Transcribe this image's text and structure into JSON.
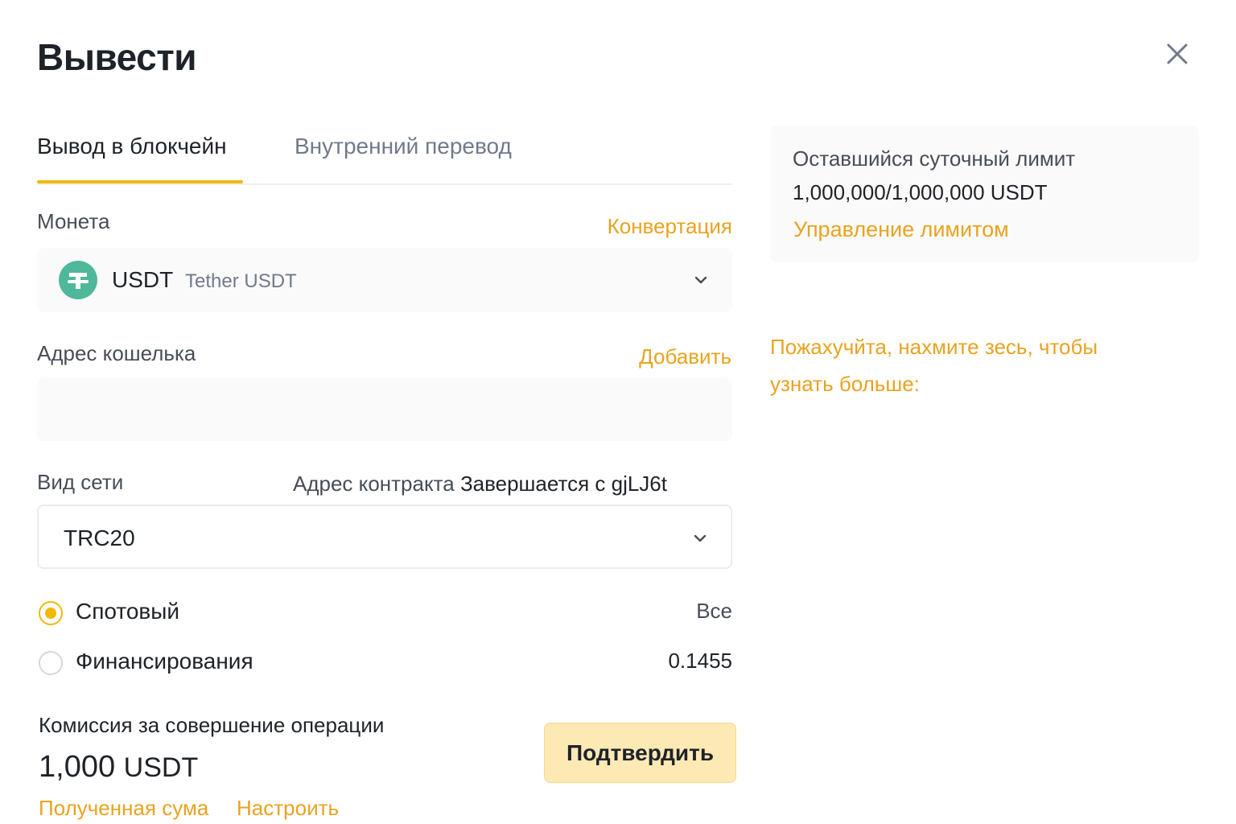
{
  "header": {
    "title": "Вывести",
    "close_icon": "close-icon"
  },
  "tabs": [
    {
      "label": "Вывод в блокчейн",
      "active": true
    },
    {
      "label": "Внутренний перевод",
      "active": false
    }
  ],
  "coin": {
    "label": "Монета",
    "convert_link": "Конвертация",
    "symbol": "USDT",
    "name": "Tether USDT",
    "icon": "tether-icon",
    "icon_color": "#50b89a"
  },
  "wallet": {
    "label": "Адрес кошелька",
    "add_link": "Добавить",
    "value": "",
    "placeholder": ""
  },
  "network": {
    "label": "Вид сети",
    "contract_label": "Адрес контракта",
    "contract_value": "Завершается с gjLJ6t",
    "selected": "TRC20"
  },
  "accounts": [
    {
      "label": "Спотовый",
      "value": "Все",
      "selected": true
    },
    {
      "label": "Финансирования",
      "value": "0.1455",
      "selected": false
    }
  ],
  "fee": {
    "label": "Комиссия за совершение операции",
    "amount": "1,000",
    "unit": "USDT",
    "received_link": "Полученная сума",
    "adjust_link": "Настроить"
  },
  "confirm_label": "Подтвердить",
  "limit": {
    "title": "Оставшийся суточный лимит",
    "value": "1,000,000/1,000,000 USDT",
    "manage_link": "Управление лимитом"
  },
  "info_text": "Пожахучйта, нахмите зесь, чтобы узнать больше:",
  "colors": {
    "accent": "#f0b90b",
    "link": "#e8a320",
    "button_bg": "#fde9b4",
    "text": "#1e2329",
    "muted": "#707a8a"
  }
}
